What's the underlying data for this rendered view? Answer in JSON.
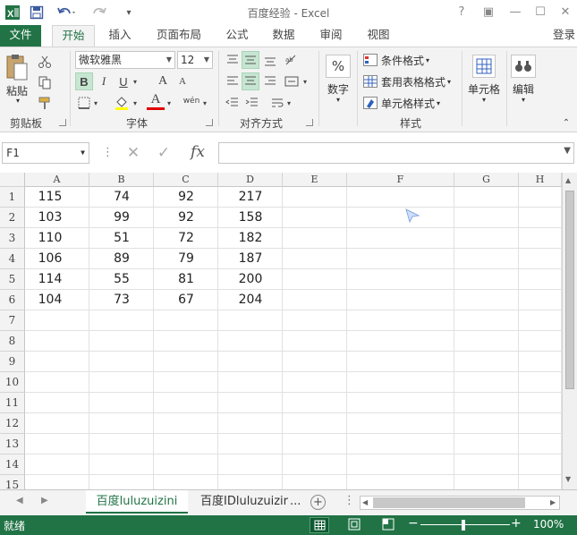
{
  "window": {
    "title": "百度经验 - Excel",
    "controls": [
      "?",
      "▣",
      "—",
      "☐",
      "✕"
    ]
  },
  "ribbon_tabs": {
    "file": "文件",
    "items": [
      "开始",
      "插入",
      "页面布局",
      "公式",
      "数据",
      "审阅",
      "视图"
    ],
    "active": "开始",
    "login": "登录"
  },
  "ribbon": {
    "clipboard": {
      "paste": "粘贴",
      "label": "剪贴板"
    },
    "font": {
      "name": "微软雅黑",
      "size": "12",
      "bold": "B",
      "italic": "I",
      "underline": "U",
      "grow": "A",
      "shrink": "A",
      "color_letter": "A",
      "phonetic": "wén",
      "label": "字体"
    },
    "alignment": {
      "label": "对齐方式"
    },
    "number": {
      "symbol": "%",
      "button": "数字"
    },
    "styles": {
      "conditional": "条件格式",
      "table": "套用表格格式",
      "cell_styles": "单元格样式",
      "label": "样式"
    },
    "cells": {
      "button": "单元格"
    },
    "editing": {
      "button": "编辑"
    }
  },
  "formula_bar": {
    "name_box": "F1",
    "fx": "fx",
    "value": ""
  },
  "grid": {
    "columns": [
      "A",
      "B",
      "C",
      "D",
      "E",
      "F",
      "G",
      "H"
    ],
    "rows": [
      "1",
      "2",
      "3",
      "4",
      "5",
      "6",
      "7",
      "8",
      "9",
      "10",
      "11",
      "12",
      "13",
      "14",
      "15"
    ],
    "data": [
      [
        "115",
        "74",
        "92",
        "217"
      ],
      [
        "103",
        "99",
        "92",
        "158"
      ],
      [
        "110",
        "51",
        "72",
        "182"
      ],
      [
        "106",
        "89",
        "79",
        "187"
      ],
      [
        "114",
        "55",
        "81",
        "200"
      ],
      [
        "104",
        "73",
        "67",
        "204"
      ]
    ]
  },
  "sheets": {
    "tabs": [
      "百度luluzuizini",
      "百度IDluluzuizir"
    ],
    "ellipsis": "...",
    "active": 0
  },
  "status": {
    "ready": "就绪",
    "zoom": "100%"
  },
  "colors": {
    "accent": "#217346"
  }
}
